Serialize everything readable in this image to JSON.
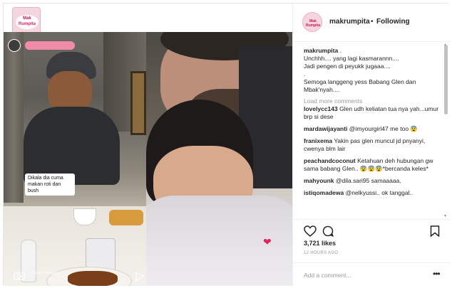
{
  "brand": {
    "logo_line1": "Mak",
    "logo_line2": "Rumpita"
  },
  "story": {
    "overlay_caption": "Dikala dia cuma makan roti dan bush",
    "reply_hint": "Kirim pesan"
  },
  "header": {
    "username": "makrumpita",
    "separator": "•",
    "follow_status": "Following",
    "avatar_text": "Mak Rumpita"
  },
  "caption": {
    "username": "makrumpita",
    "lines": [
      ".",
      "Unchhh.... yang lagi kasmarannn....",
      "Jadi pengen di peyukk jugaaa....",
      ".",
      "Semoga langgeng yess Babang Glen dan",
      "Mbak'nyah...."
    ]
  },
  "load_more": "Load more comments",
  "comments": [
    {
      "user": "lovelycc143",
      "text": "Glen udh keliatan tua nya yah...umur brp si dese"
    },
    {
      "user": "mardawijayanti",
      "text": "@imyourgirl47 me too 😨"
    },
    {
      "user": "franixema",
      "text": "Yakin pas glen muncul jd pnyanyi, cwenya blm lair"
    },
    {
      "user": "peachandcoconut",
      "text": "Ketahuan deh hubungan gw sama babang Glen.. 😨😨😨*bercanda keles*"
    },
    {
      "user": "mahyounk",
      "text": "@dila.sari95 samaaaaa."
    },
    {
      "user": "istiqomadewa",
      "text": "@nelkyussi.. ok tanggal.."
    }
  ],
  "actions": {
    "likes": "3,721 likes",
    "time": "12 HOURS AGO",
    "add_comment_placeholder": "Add a comment...",
    "more": "•••"
  },
  "colors": {
    "like_heart": "#e0245e",
    "muted": "#999999",
    "text": "#262626"
  }
}
